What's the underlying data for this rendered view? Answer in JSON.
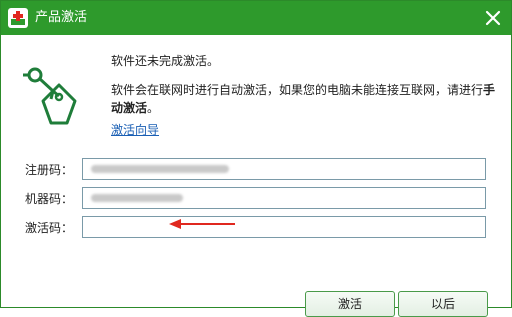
{
  "window": {
    "title": "产品激活",
    "close_glyph": "✕"
  },
  "message": {
    "line1": "软件还未完成激活。",
    "line2_prefix": "软件会在联网时进行自动激活，如果您的电脑未能连接互联网，请进行",
    "line2_bold": "手动激活",
    "line2_suffix": "。"
  },
  "wizard_link": "激活向导",
  "fields": {
    "registration": {
      "label": "注册码：",
      "value_blurred": true
    },
    "machine": {
      "label": "机器码：",
      "value_blurred": true
    },
    "activation": {
      "label": "激活码：",
      "value": ""
    }
  },
  "buttons": {
    "activate": "激活",
    "later": "以后"
  },
  "colors": {
    "titlebar": "#2e9a2c",
    "accent_green": "#1f7d3a",
    "arrow": "#e0281f",
    "link": "#1a5fb4"
  }
}
